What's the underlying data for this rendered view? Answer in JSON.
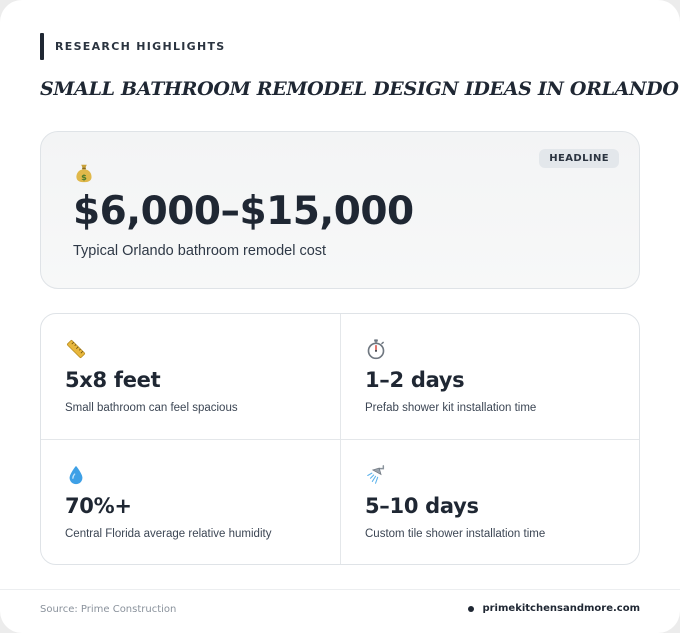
{
  "eyebrow": "RESEARCH HIGHLIGHTS",
  "title": "SMALL BATHROOM REMODEL DESIGN IDEAS IN ORLANDO FL",
  "headline": {
    "badge": "HEADLINE",
    "icon": "money-bag-icon",
    "value": "$6,000–$15,000",
    "caption": "Typical Orlando bathroom remodel cost"
  },
  "stats": [
    {
      "icon": "ruler-icon",
      "value": "5x8 feet",
      "caption": "Small bathroom can feel spacious"
    },
    {
      "icon": "stopwatch-icon",
      "value": "1–2 days",
      "caption": "Prefab shower kit installation time"
    },
    {
      "icon": "droplet-icon",
      "value": "70%+",
      "caption": "Central Florida average relative humidity"
    },
    {
      "icon": "shower-icon",
      "value": "5–10 days",
      "caption": "Custom tile shower installation time"
    }
  ],
  "footer": {
    "source": "Source: Prime Construction",
    "site": "primekitchensandmore.com"
  },
  "colors": {
    "text": "#1f2733",
    "border": "#dfe3e7",
    "badge_bg": "#e3e7eb",
    "muted": "#8a929c"
  }
}
